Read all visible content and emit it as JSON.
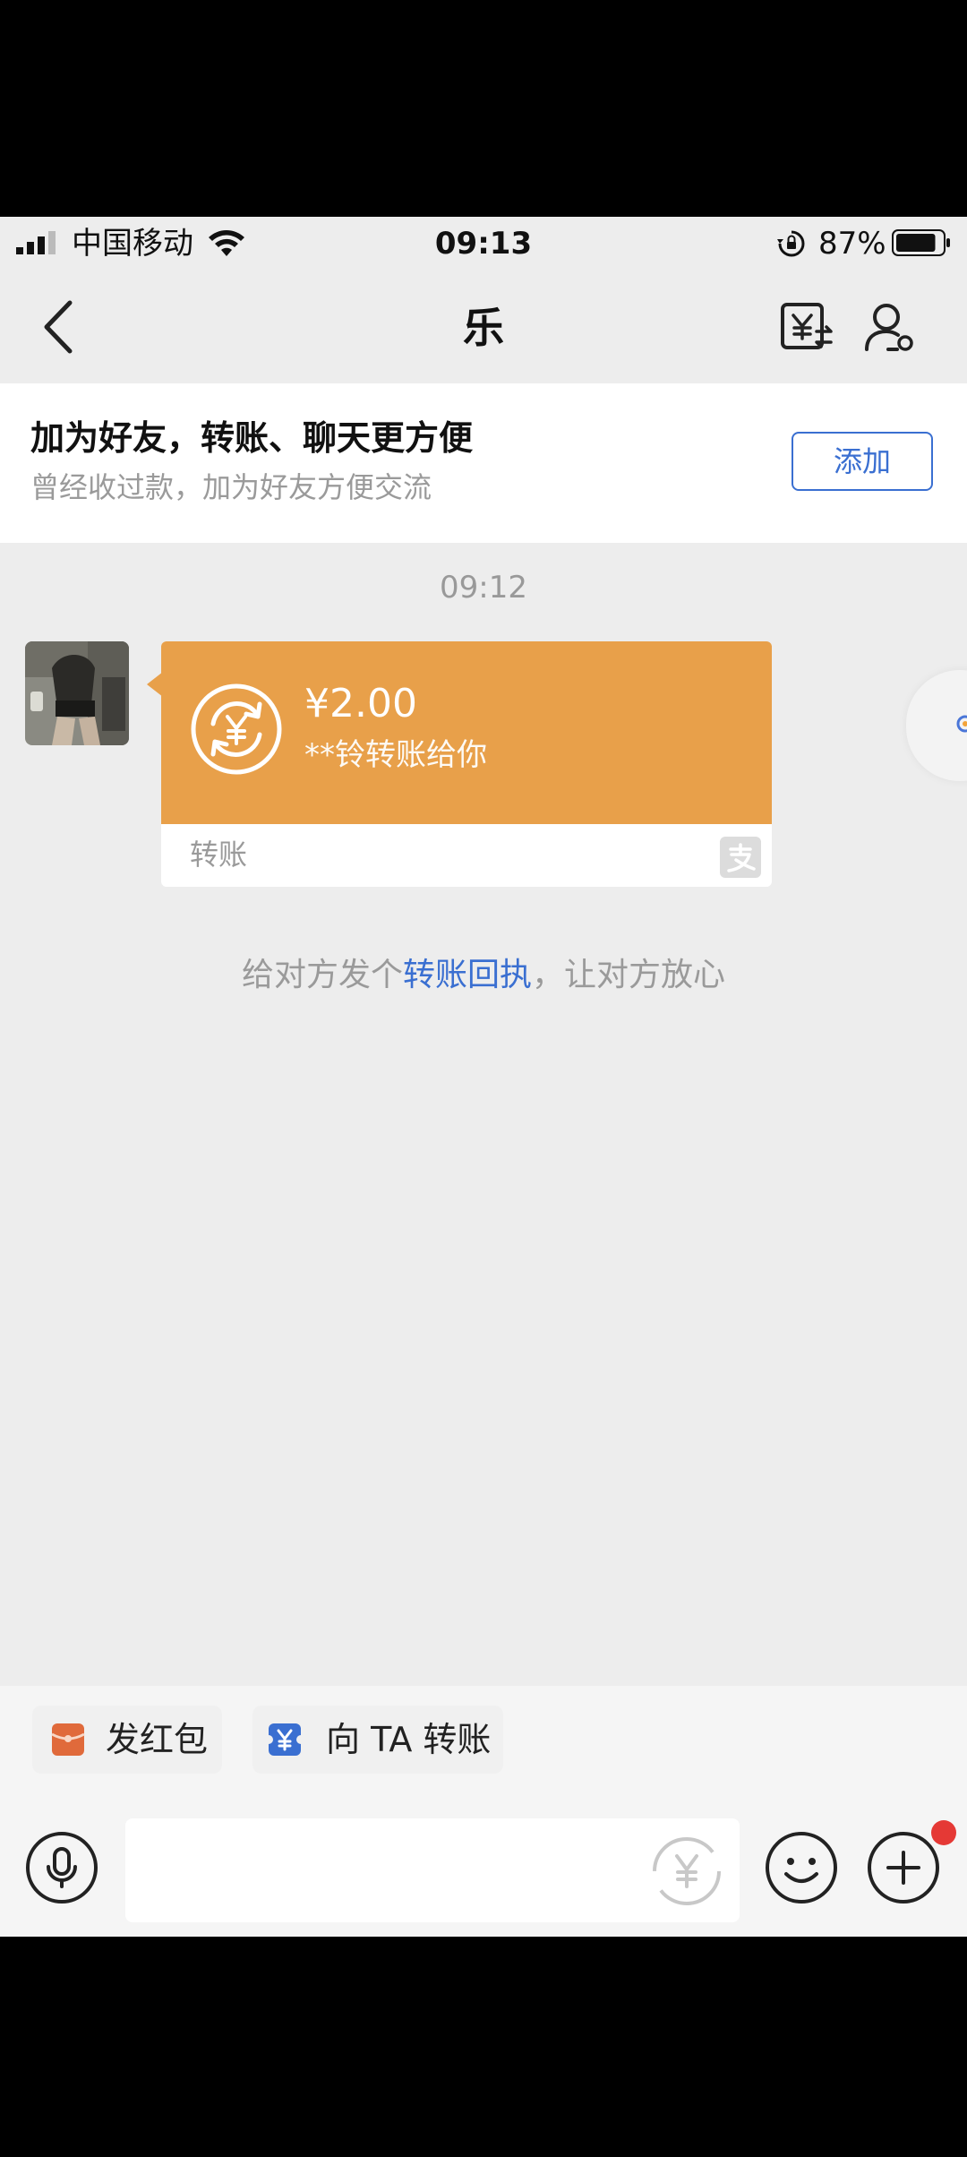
{
  "status_bar": {
    "carrier": "中国移动",
    "time": "09:13",
    "battery": "87%",
    "battery_level": 0.87
  },
  "nav": {
    "title": "乐"
  },
  "banner": {
    "title": "加为好友，转账、聊天更方便",
    "subtitle": "曾经收过款，加为好友方便交流",
    "add_button": "添加"
  },
  "chat": {
    "timestamp": "09:12",
    "transfer_card": {
      "amount": "¥2.00",
      "description": "**铃转账给你",
      "footer_label": "转账"
    },
    "receipt_hint": {
      "prefix": "给对方发个",
      "link": "转账回执",
      "suffix": "，让对方放心"
    }
  },
  "quick_actions": [
    {
      "label": "发红包",
      "icon": "red-packet-icon",
      "color": "#e06a3b"
    },
    {
      "label": "向 TA 转账",
      "icon": "transfer-icon",
      "color": "#3a6fd1"
    }
  ],
  "colors": {
    "card_orange": "#e8a04a",
    "link_blue": "#3a6fd1",
    "badge_red": "#e53935"
  }
}
